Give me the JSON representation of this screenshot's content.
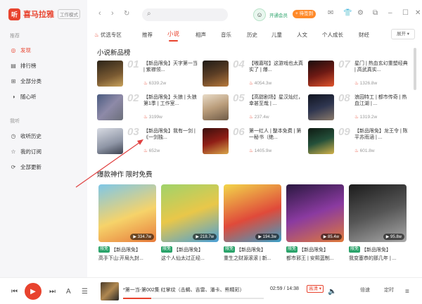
{
  "app": {
    "logo_char": "听",
    "name": "喜马拉雅",
    "mode": "工作模式"
  },
  "sidebar": {
    "section_recommend": "推荐",
    "section_mine": "我听",
    "items": [
      {
        "label": "发现",
        "icon": "discover-icon",
        "active": true
      },
      {
        "label": "排行榜",
        "icon": "chart-icon"
      },
      {
        "label": "全部分类",
        "icon": "grid-icon"
      },
      {
        "label": "随心听",
        "icon": "radio-icon"
      }
    ],
    "my_items": [
      {
        "label": "收听历史",
        "icon": "clock-icon"
      },
      {
        "label": "我的订阅",
        "icon": "star-icon"
      },
      {
        "label": "全部更新",
        "icon": "refresh-icon"
      }
    ]
  },
  "topbar": {
    "vip_label": "开通会员",
    "checkin_label": "+ 待签到"
  },
  "tabs": {
    "items": [
      "优选专区",
      "推荐",
      "小说",
      "相声",
      "音乐",
      "历史",
      "儿童",
      "人文",
      "个人成长",
      "财经"
    ],
    "active": "小说",
    "expand_label": "展开 ▾"
  },
  "ranking": {
    "title": "小说新品榜",
    "items": [
      {
        "rank": "01",
        "title": "【新品限免】天字第一当 | 紫襟领...",
        "heat": "6339.2w"
      },
      {
        "rank": "02",
        "title": "【新品限免】头狼 | 头狼第1季 | 工作室...",
        "heat": "3199w"
      },
      {
        "rank": "03",
        "title": "【新品限免】我有一剑 | 《一剑独...",
        "heat": "652w"
      },
      {
        "rank": "04",
        "title": "【嗷嘉啦】这游戏也太真实了 | 爆...",
        "heat": "4054.3w"
      },
      {
        "rank": "05",
        "title": "【高甜剧场】星汉灿烂，幸甚至哉 | ...",
        "heat": "237.4w"
      },
      {
        "rank": "06",
        "title": "第一红人 | 整本免费 | 第一秘书（绝...",
        "heat": "1405.9w"
      },
      {
        "rank": "07",
        "title": "星门 | 热血玄幻重塑经典 | 高武真实...",
        "heat": "1326.8w"
      },
      {
        "rank": "08",
        "title": "浪园特工 | 都市传奇 | 热血江湖 | ...",
        "heat": "1319.2w"
      },
      {
        "rank": "09",
        "title": "【新品限免】龙王令 | 陈平苏雨涵 | ...",
        "heat": "601.8w"
      }
    ]
  },
  "free": {
    "title": "爆款神作 限时免费",
    "tag": "限免",
    "items": [
      {
        "sub": "【新品限免】",
        "title": "高手下山:开局九封...",
        "plays": "334.7w"
      },
      {
        "sub": "【新品限免】",
        "title": "这个人仙太过正经...",
        "plays": "218.7w"
      },
      {
        "sub": "【新品限免】",
        "title": "重生之财源滚滚 | 新...",
        "plays": "194.3w"
      },
      {
        "sub": "【新品限免】",
        "title": "都市邪王 | 安熙蓝制...",
        "plays": "85.4w"
      },
      {
        "sub": "【新品限免】",
        "title": "我变塞恭的那几年 | ...",
        "plays": "95.8w"
      }
    ]
  },
  "player": {
    "title": "*第一当-第002集 红掌纹（击蝎、吉雷、潘卡、熊精彩）",
    "time": "02:59 / 14:38",
    "quality": "高清 ▾",
    "speed_label": "倍速",
    "timer_label": "定时",
    "progress": 0.2
  }
}
